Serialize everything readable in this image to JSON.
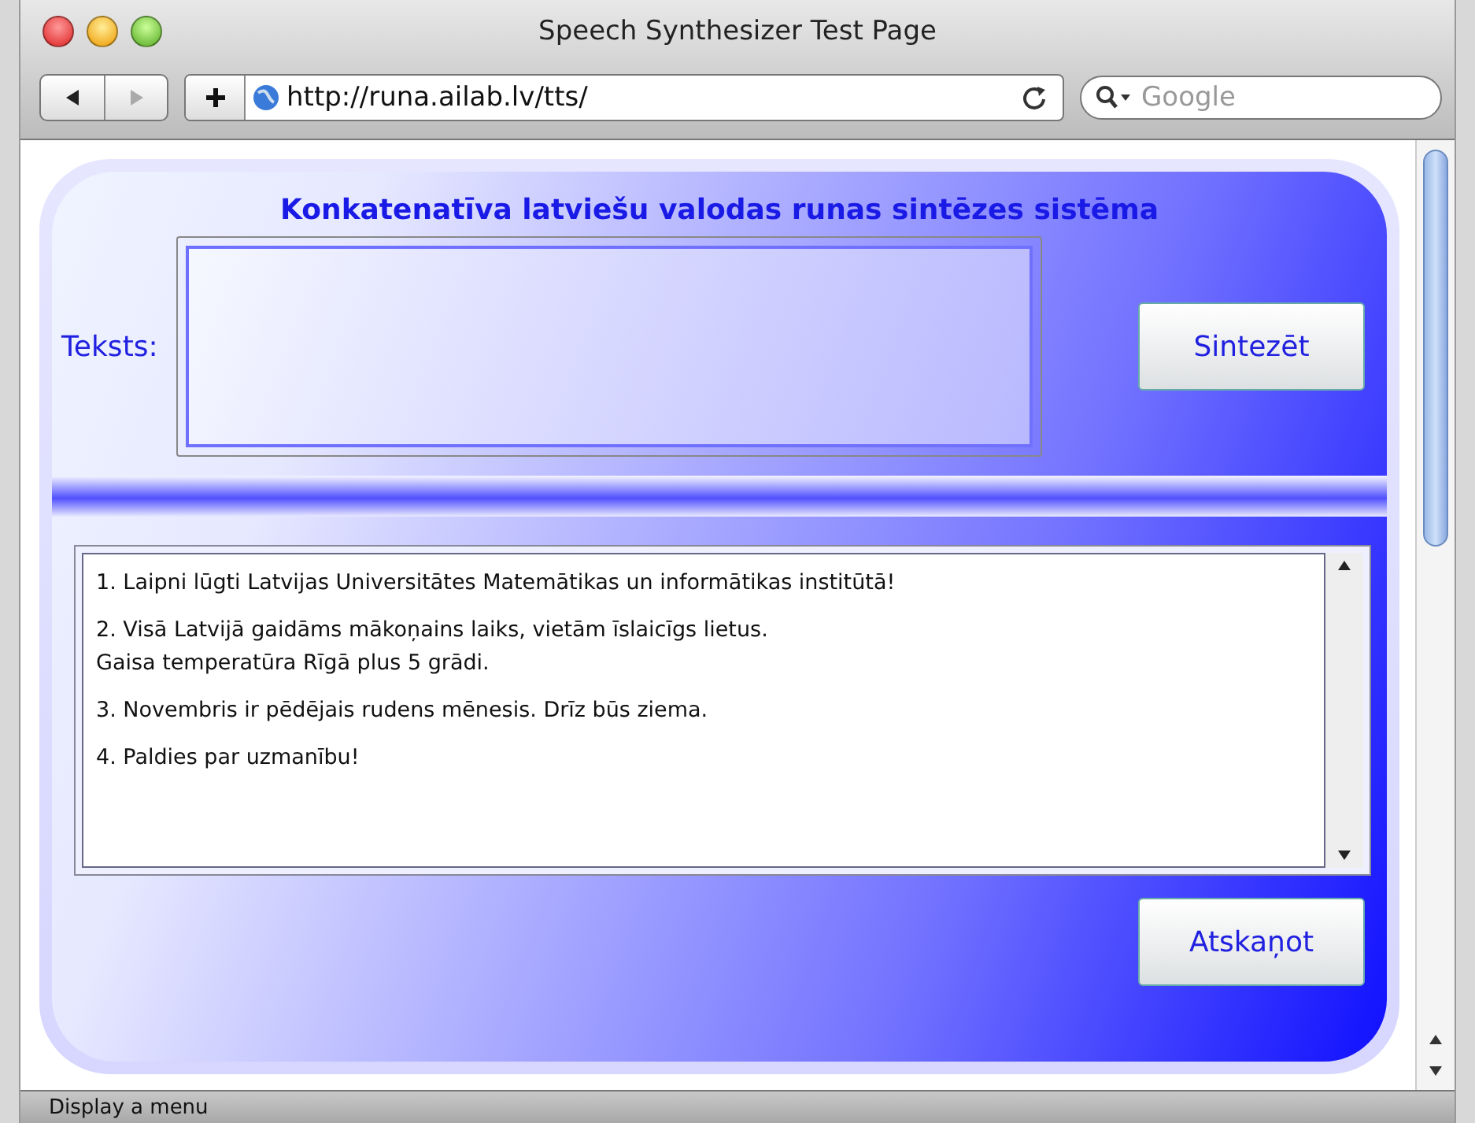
{
  "window": {
    "title": "Speech Synthesizer Test Page"
  },
  "toolbar": {
    "url": "http://runa.ailab.lv/tts/",
    "search": {
      "placeholder": "Google"
    }
  },
  "page": {
    "heading": "Konkatenatīva latviešu valodas runas sintēzes sistēma",
    "text_label": "Teksts:",
    "synthesize_button": "Sintezēt",
    "examples": [
      [
        "1. Laipni lūgti Latvijas Universitātes Matemātikas un informātikas institūtā!"
      ],
      [
        "2. Visā Latvijā gaidāms mākoņains laiks, vietām īslaicīgs lietus.",
        "Gaisa temperatūra Rīgā plus 5 grādi."
      ],
      [
        "3. Novembris ir pēdējais rudens mēnesis. Drīz būs ziema."
      ],
      [
        "4. Paldies par uzmanību!"
      ]
    ],
    "play_button": "Atskaņot"
  },
  "status_bar": "Display a menu"
}
